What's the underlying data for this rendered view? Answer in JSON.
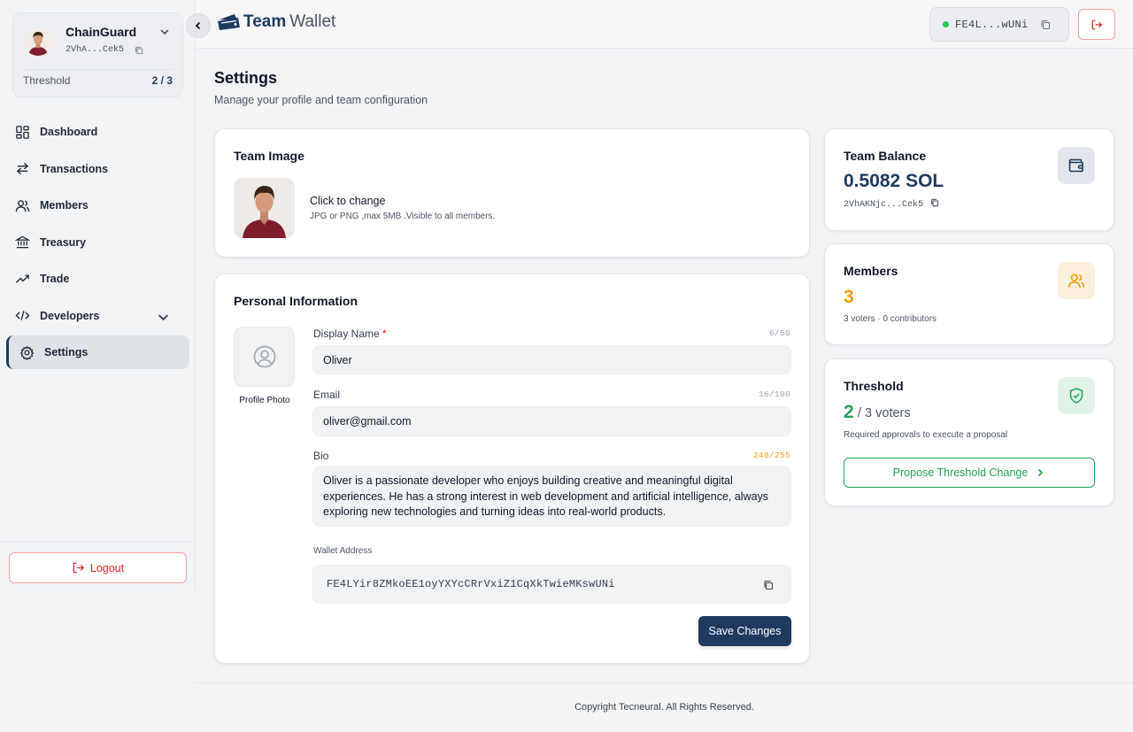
{
  "app": {
    "logo_bold": "Team",
    "logo_light": "Wallet"
  },
  "team": {
    "name": "ChainGuard",
    "address_short": "2VhA...Cek5",
    "threshold_label": "Threshold",
    "threshold_value": "2 / 3"
  },
  "sidebar": {
    "items": [
      {
        "label": "Dashboard",
        "icon": "dashboard-icon"
      },
      {
        "label": "Transactions",
        "icon": "transactions-icon"
      },
      {
        "label": "Members",
        "icon": "members-icon"
      },
      {
        "label": "Treasury",
        "icon": "treasury-icon"
      },
      {
        "label": "Trade",
        "icon": "trade-icon"
      },
      {
        "label": "Developers",
        "icon": "code-icon"
      },
      {
        "label": "Settings",
        "icon": "settings-icon",
        "active": true
      }
    ],
    "logout_label": "Logout"
  },
  "header": {
    "wallet_short": "FE4L...wUNi",
    "status_color": "#22c55e"
  },
  "page": {
    "title": "Settings",
    "subtitle": "Manage your profile and team configuration"
  },
  "team_image": {
    "title": "Team Image",
    "heading": "Click to change",
    "hint": "JPG or PNG ,max 5MB .Visible to all members."
  },
  "personal": {
    "title": "Personal Information",
    "photo_label": "Profile Photo",
    "display_name": {
      "label": "Display Name",
      "required_mark": "*",
      "value": "Oliver",
      "count": "6/50"
    },
    "email": {
      "label": "Email",
      "value": "oliver@gmail.com",
      "count": "16/100"
    },
    "bio": {
      "label": "Bio",
      "count": "248/255",
      "value": "Oliver is a passionate developer who enjoys building creative and meaningful digital experiences. He has a strong interest in web development and artificial intelligence, always exploring new technologies and turning ideas into real-world products."
    },
    "wallet": {
      "label": "Wallet Address",
      "value": "FE4LYir8ZMkoEE1oyYXYcCRrVxiZ1CqXkTwieMKswUNi"
    },
    "save_label": "Save Changes"
  },
  "balance": {
    "title": "Team Balance",
    "value": "0.5082 SOL",
    "address": "2VhAKNjc...Cek5"
  },
  "members": {
    "title": "Members",
    "count": "3",
    "subtitle": "3 voters · 0 contributors"
  },
  "threshold": {
    "title": "Threshold",
    "value": "2",
    "of_text": "/ 3 voters",
    "subtitle": "Required approvals to execute a proposal",
    "button_label": "Propose Threshold Change"
  },
  "footer": {
    "text": "Copyright Tecneural. All Rights Reserved."
  },
  "colors": {
    "primary": "#1e3a5f",
    "success": "#22a35a",
    "warning": "#f59e0b",
    "danger": "#dc2626"
  }
}
